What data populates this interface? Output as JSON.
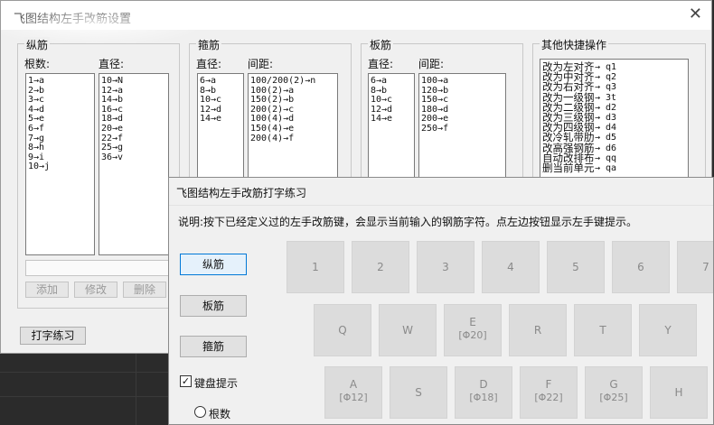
{
  "main_dialog": {
    "title": "飞图结构左手改筋设置",
    "close_glyph": "✕",
    "longitudinal": {
      "group_label": "纵筋",
      "count_label": "根数:",
      "diameter_label": "直径:",
      "count_items": [
        "1→a",
        "2→b",
        "3→c",
        "4→d",
        "5→e",
        "6→f",
        "7→g",
        "8→h",
        "9→i",
        "10→j"
      ],
      "diameter_items": [
        "10→N",
        "12→a",
        "14→b",
        "16→c",
        "18→d",
        "20→e",
        "22→f",
        "25→g",
        "36→v"
      ]
    },
    "stirrup": {
      "group_label": "箍筋",
      "diameter_label": "直径:",
      "spacing_label": "间距:",
      "diameter_items": [
        "6→a",
        "8→b",
        "10→c",
        "12→d",
        "14→e"
      ],
      "spacing_items": [
        "100/200(2)→n",
        "100(2)→a",
        "150(2)→b",
        "200(2)→c",
        "100(4)→d",
        "150(4)→e",
        "200(4)→f"
      ]
    },
    "slab": {
      "group_label": "板筋",
      "diameter_label": "直径:",
      "spacing_label": "间距:",
      "diameter_items": [
        "6→a",
        "8→b",
        "10→c",
        "12→d",
        "14→e"
      ],
      "spacing_items": [
        "100→a",
        "120→b",
        "150→c",
        "180→d",
        "200→e",
        "250→f"
      ]
    },
    "shortcuts": {
      "group_label": "其他快捷操作",
      "items": [
        {
          "action": "改为左对齐",
          "key": "→ q1"
        },
        {
          "action": "改为中对齐",
          "key": "→ q2"
        },
        {
          "action": "改为右对齐",
          "key": "→ q3"
        },
        {
          "action": "改为一级钢",
          "key": "→ 3t"
        },
        {
          "action": "改为二级钢",
          "key": "→ d2"
        },
        {
          "action": "改为三级钢",
          "key": "→ d3"
        },
        {
          "action": "改为四级钢",
          "key": "→ d4"
        },
        {
          "action": "改冷轧带肋",
          "key": "→ d5"
        },
        {
          "action": "改高强钢筋",
          "key": "→ d6"
        },
        {
          "action": "自动改排布",
          "key": "→ qq"
        },
        {
          "action": "删当前单元",
          "key": "→ qa"
        }
      ]
    },
    "buttons": {
      "add": "添加",
      "modify": "修改",
      "delete": "删除",
      "typing_practice": "打字练习"
    }
  },
  "practice_dialog": {
    "title": "飞图结构左手改筋打字练习",
    "description": "说明:按下已经定义过的左手改筋键，会显示当前输入的钢筋字符。点左边按钮显示左手键提示。",
    "side_buttons": {
      "longitudinal": "纵筋",
      "slab": "板筋",
      "stirrup": "箍筋"
    },
    "keyboard_hint_label": "键盘提示",
    "keyboard_hint_checked": true,
    "count_radio_label": "根数",
    "keyboard": {
      "row1": [
        {
          "key": "1",
          "hint": ""
        },
        {
          "key": "2",
          "hint": ""
        },
        {
          "key": "3",
          "hint": ""
        },
        {
          "key": "4",
          "hint": ""
        },
        {
          "key": "5",
          "hint": ""
        },
        {
          "key": "6",
          "hint": ""
        },
        {
          "key": "7",
          "hint": ""
        }
      ],
      "row2": [
        {
          "key": "Q",
          "hint": ""
        },
        {
          "key": "W",
          "hint": ""
        },
        {
          "key": "E",
          "hint": "[Φ20]"
        },
        {
          "key": "R",
          "hint": ""
        },
        {
          "key": "T",
          "hint": ""
        },
        {
          "key": "Y",
          "hint": ""
        }
      ],
      "row3": [
        {
          "key": "A",
          "hint": "[Φ12]"
        },
        {
          "key": "S",
          "hint": ""
        },
        {
          "key": "D",
          "hint": "[Φ18]"
        },
        {
          "key": "F",
          "hint": "[Φ22]"
        },
        {
          "key": "G",
          "hint": "[Φ25]"
        },
        {
          "key": "H",
          "hint": ""
        }
      ]
    }
  }
}
